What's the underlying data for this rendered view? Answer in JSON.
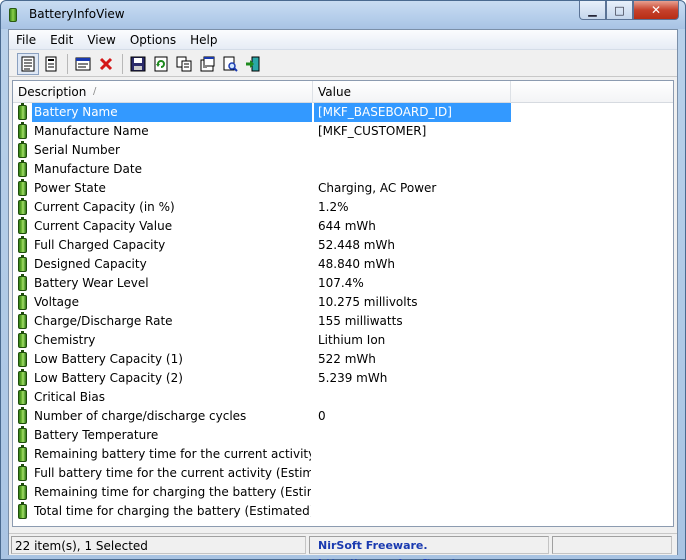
{
  "window": {
    "title": "BatteryInfoView",
    "minimize_glyph": "▁",
    "maximize_glyph": "□",
    "close_glyph": "✕"
  },
  "menu": [
    "File",
    "Edit",
    "View",
    "Options",
    "Help"
  ],
  "toolbar": {
    "icons": [
      "html-report-icon",
      "properties-icon",
      "log-window-icon",
      "delete-icon",
      "save-icon",
      "refresh-icon",
      "copy-icon",
      "properties-window-icon",
      "find-icon",
      "exit-icon"
    ]
  },
  "columns": {
    "description": "Description",
    "value": "Value",
    "sort_indicator": "/"
  },
  "rows": [
    {
      "description": "Battery Name",
      "value": "[MKF_BASEBOARD_ID]",
      "selected": true
    },
    {
      "description": "Manufacture Name",
      "value": "[MKF_CUSTOMER]"
    },
    {
      "description": "Serial Number",
      "value": ""
    },
    {
      "description": "Manufacture Date",
      "value": ""
    },
    {
      "description": "Power State",
      "value": "Charging, AC Power"
    },
    {
      "description": "Current Capacity (in %)",
      "value": "1.2%"
    },
    {
      "description": "Current Capacity Value",
      "value": "644 mWh"
    },
    {
      "description": "Full Charged Capacity",
      "value": "52.448 mWh"
    },
    {
      "description": "Designed Capacity",
      "value": "48.840 mWh"
    },
    {
      "description": "Battery Wear Level",
      "value": "107.4%"
    },
    {
      "description": "Voltage",
      "value": "10.275 millivolts"
    },
    {
      "description": "Charge/Discharge Rate",
      "value": "155 milliwatts"
    },
    {
      "description": "Chemistry",
      "value": "Lithium Ion"
    },
    {
      "description": "Low Battery Capacity (1)",
      "value": "522 mWh"
    },
    {
      "description": "Low Battery Capacity (2)",
      "value": "5.239 mWh"
    },
    {
      "description": "Critical Bias",
      "value": ""
    },
    {
      "description": "Number of charge/discharge cycles",
      "value": "0"
    },
    {
      "description": "Battery Temperature",
      "value": ""
    },
    {
      "description": "Remaining battery time for the current activity (Est...",
      "value": ""
    },
    {
      "description": "Full battery time for the current activity (Estimated)",
      "value": ""
    },
    {
      "description": "Remaining time for charging the battery (Estimated)",
      "value": ""
    },
    {
      "description": "Total  time for charging the battery (Estimated)",
      "value": ""
    }
  ],
  "status": {
    "items": "22 item(s), 1 Selected",
    "credit": "NirSoft Freeware.  http://www.nirsoft.net"
  },
  "colors": {
    "selection": "#3399ff",
    "credit_text": "#1a3ab0",
    "battery_green": "#79c43a"
  }
}
